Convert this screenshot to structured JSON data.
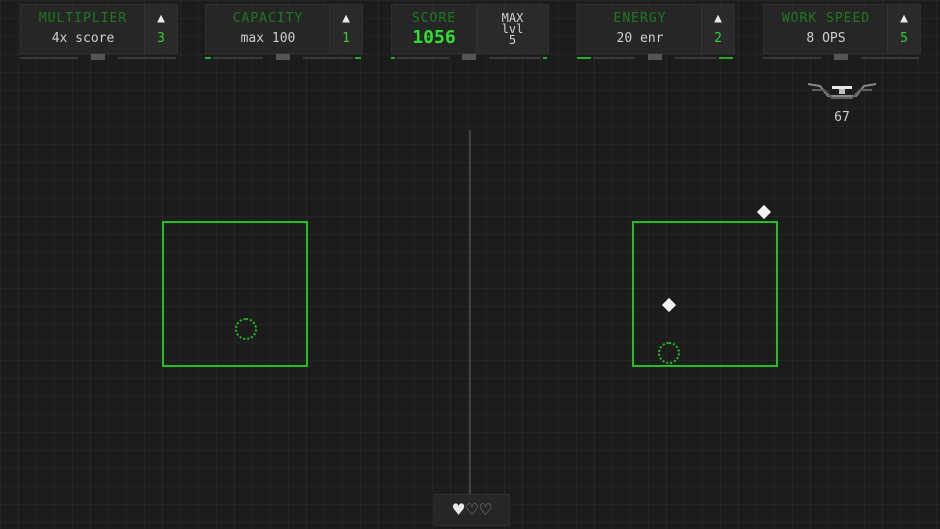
{
  "upgrades": [
    {
      "label": "MULTIPLIER",
      "value": "4x score",
      "level": "3",
      "bar": [
        0,
        0,
        0
      ]
    },
    {
      "label": "CAPACITY",
      "value": "max 100",
      "level": "1",
      "bar": [
        1,
        0,
        1
      ]
    },
    {
      "label": "ENERGY",
      "value": "20 enr",
      "level": "2",
      "bar": [
        1,
        0,
        1
      ]
    },
    {
      "label": "WORK SPEED",
      "value": "8 OPS",
      "level": "5",
      "bar": [
        0,
        0,
        0
      ]
    }
  ],
  "score": {
    "label": "SCORE",
    "value": "1056",
    "max_line1": "MAX",
    "max_line2": "lvl",
    "max_line3": "5"
  },
  "counter": {
    "value": "67",
    "icon": "drone-icon"
  },
  "lives": {
    "total": 3,
    "remaining": 1,
    "icon_full": "heart-full-icon",
    "icon_empty": "heart-empty-icon"
  },
  "colors": {
    "accent": "#22c022",
    "label": "#1f7a1f",
    "text": "#cfcfcf",
    "background": "#1c1c1c"
  }
}
